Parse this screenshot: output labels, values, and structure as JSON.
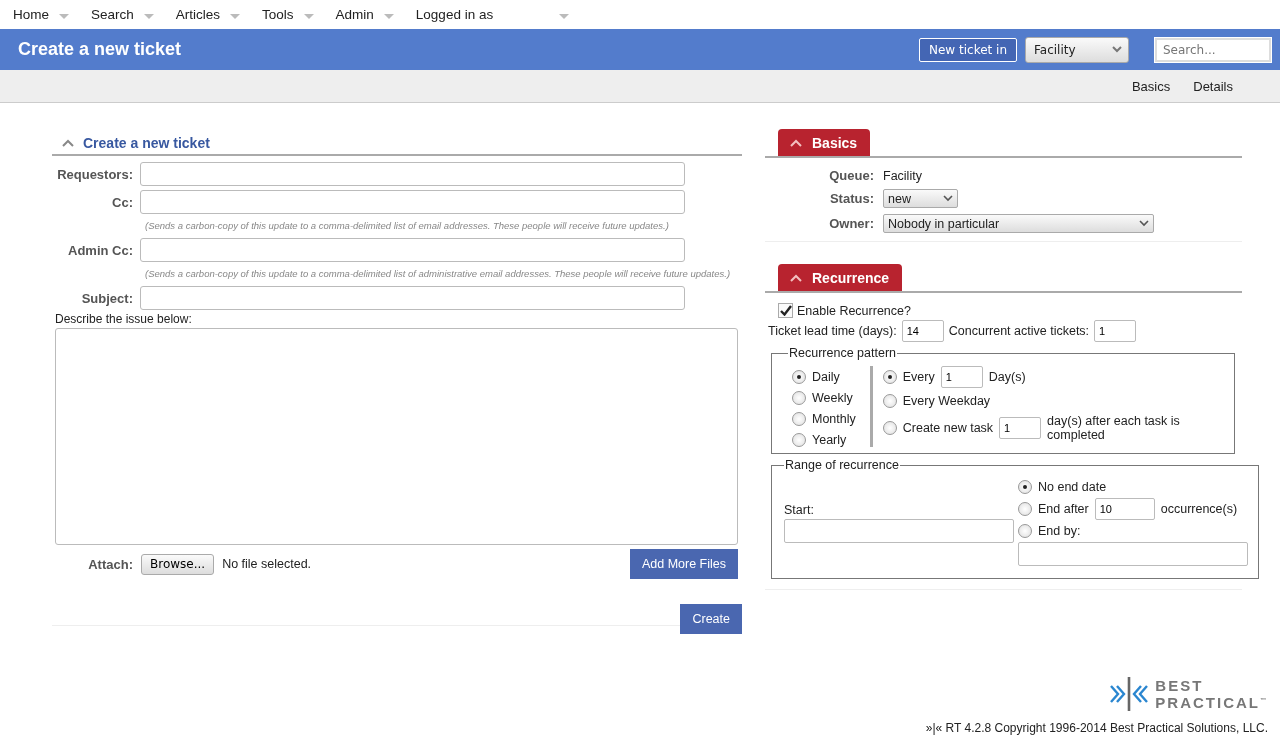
{
  "menu": [
    {
      "label": "Home"
    },
    {
      "label": "Search"
    },
    {
      "label": "Articles"
    },
    {
      "label": "Tools"
    },
    {
      "label": "Admin"
    },
    {
      "label": "Logged in as"
    }
  ],
  "header": {
    "title": "Create a new ticket",
    "new_ticket_button": "New ticket in",
    "queue_select": "Facility",
    "search": {
      "placeholder": "Search..."
    }
  },
  "subnav": [
    {
      "label": "Basics"
    },
    {
      "label": "Details"
    }
  ],
  "create_panel": {
    "title": "Create a new ticket",
    "expanded": true,
    "fields": [
      {
        "label": "Requestors:"
      },
      {
        "label": "Cc:",
        "hint": "(Sends a carbon-copy of this update to a comma-delimited list of email addresses. These people will receive future updates.)"
      },
      {
        "label": "Admin Cc:",
        "hint": "(Sends a carbon-copy of this update to a comma-delimited list of administrative email addresses. These people will receive future updates.)"
      },
      {
        "label": "Subject:"
      }
    ],
    "describe_label": "Describe the issue below:",
    "attach_label": "Attach:",
    "browse_button": "Browse...",
    "no_file": "No file selected.",
    "add_files_button": "Add More Files",
    "create_button": "Create"
  },
  "basics_panel": {
    "title": "Basics",
    "expanded": true,
    "queue_label": "Queue:",
    "queue_value": "Facility",
    "status_label": "Status:",
    "status_value": "new",
    "owner_label": "Owner:",
    "owner_value": "Nobody in particular"
  },
  "recurrence_panel": {
    "title": "Recurrence",
    "expanded": true,
    "enable": {
      "label": "Enable Recurrence?",
      "checked": true
    },
    "lead_time_label": "Ticket lead time (days):",
    "lead_time_value": "14",
    "concurrent_label": "Concurrent active tickets:",
    "concurrent_value": "1",
    "pattern": {
      "legend": "Recurrence pattern",
      "frequencies": [
        {
          "label": "Daily",
          "selected": true
        },
        {
          "label": "Weekly",
          "selected": false
        },
        {
          "label": "Monthly",
          "selected": false
        },
        {
          "label": "Yearly",
          "selected": false
        }
      ],
      "daily_options": [
        {
          "kind": "every",
          "label": "Every",
          "value": "1",
          "suffix": "Day(s)",
          "selected": true
        },
        {
          "kind": "weekday",
          "label": "Every Weekday",
          "selected": false
        },
        {
          "kind": "after",
          "label": "Create new task",
          "value": "1",
          "suffix": "day(s) after each task is completed",
          "selected": false
        }
      ]
    },
    "range": {
      "legend": "Range of recurrence",
      "start_label": "Start:",
      "end_options": [
        {
          "kind": "none",
          "label": "No end date",
          "selected": true
        },
        {
          "kind": "after",
          "label": "End after",
          "value": "10",
          "suffix": "occurrence(s)",
          "selected": false
        },
        {
          "kind": "by",
          "label": "End by:",
          "selected": false
        }
      ]
    }
  },
  "footer": {
    "logo_line1": "BEST",
    "logo_line2": "PRACTICAL",
    "logo_tm": "™",
    "copyright": "»|« RT 4.2.8 Copyright 1996-2014 Best Practical Solutions, LLC."
  }
}
